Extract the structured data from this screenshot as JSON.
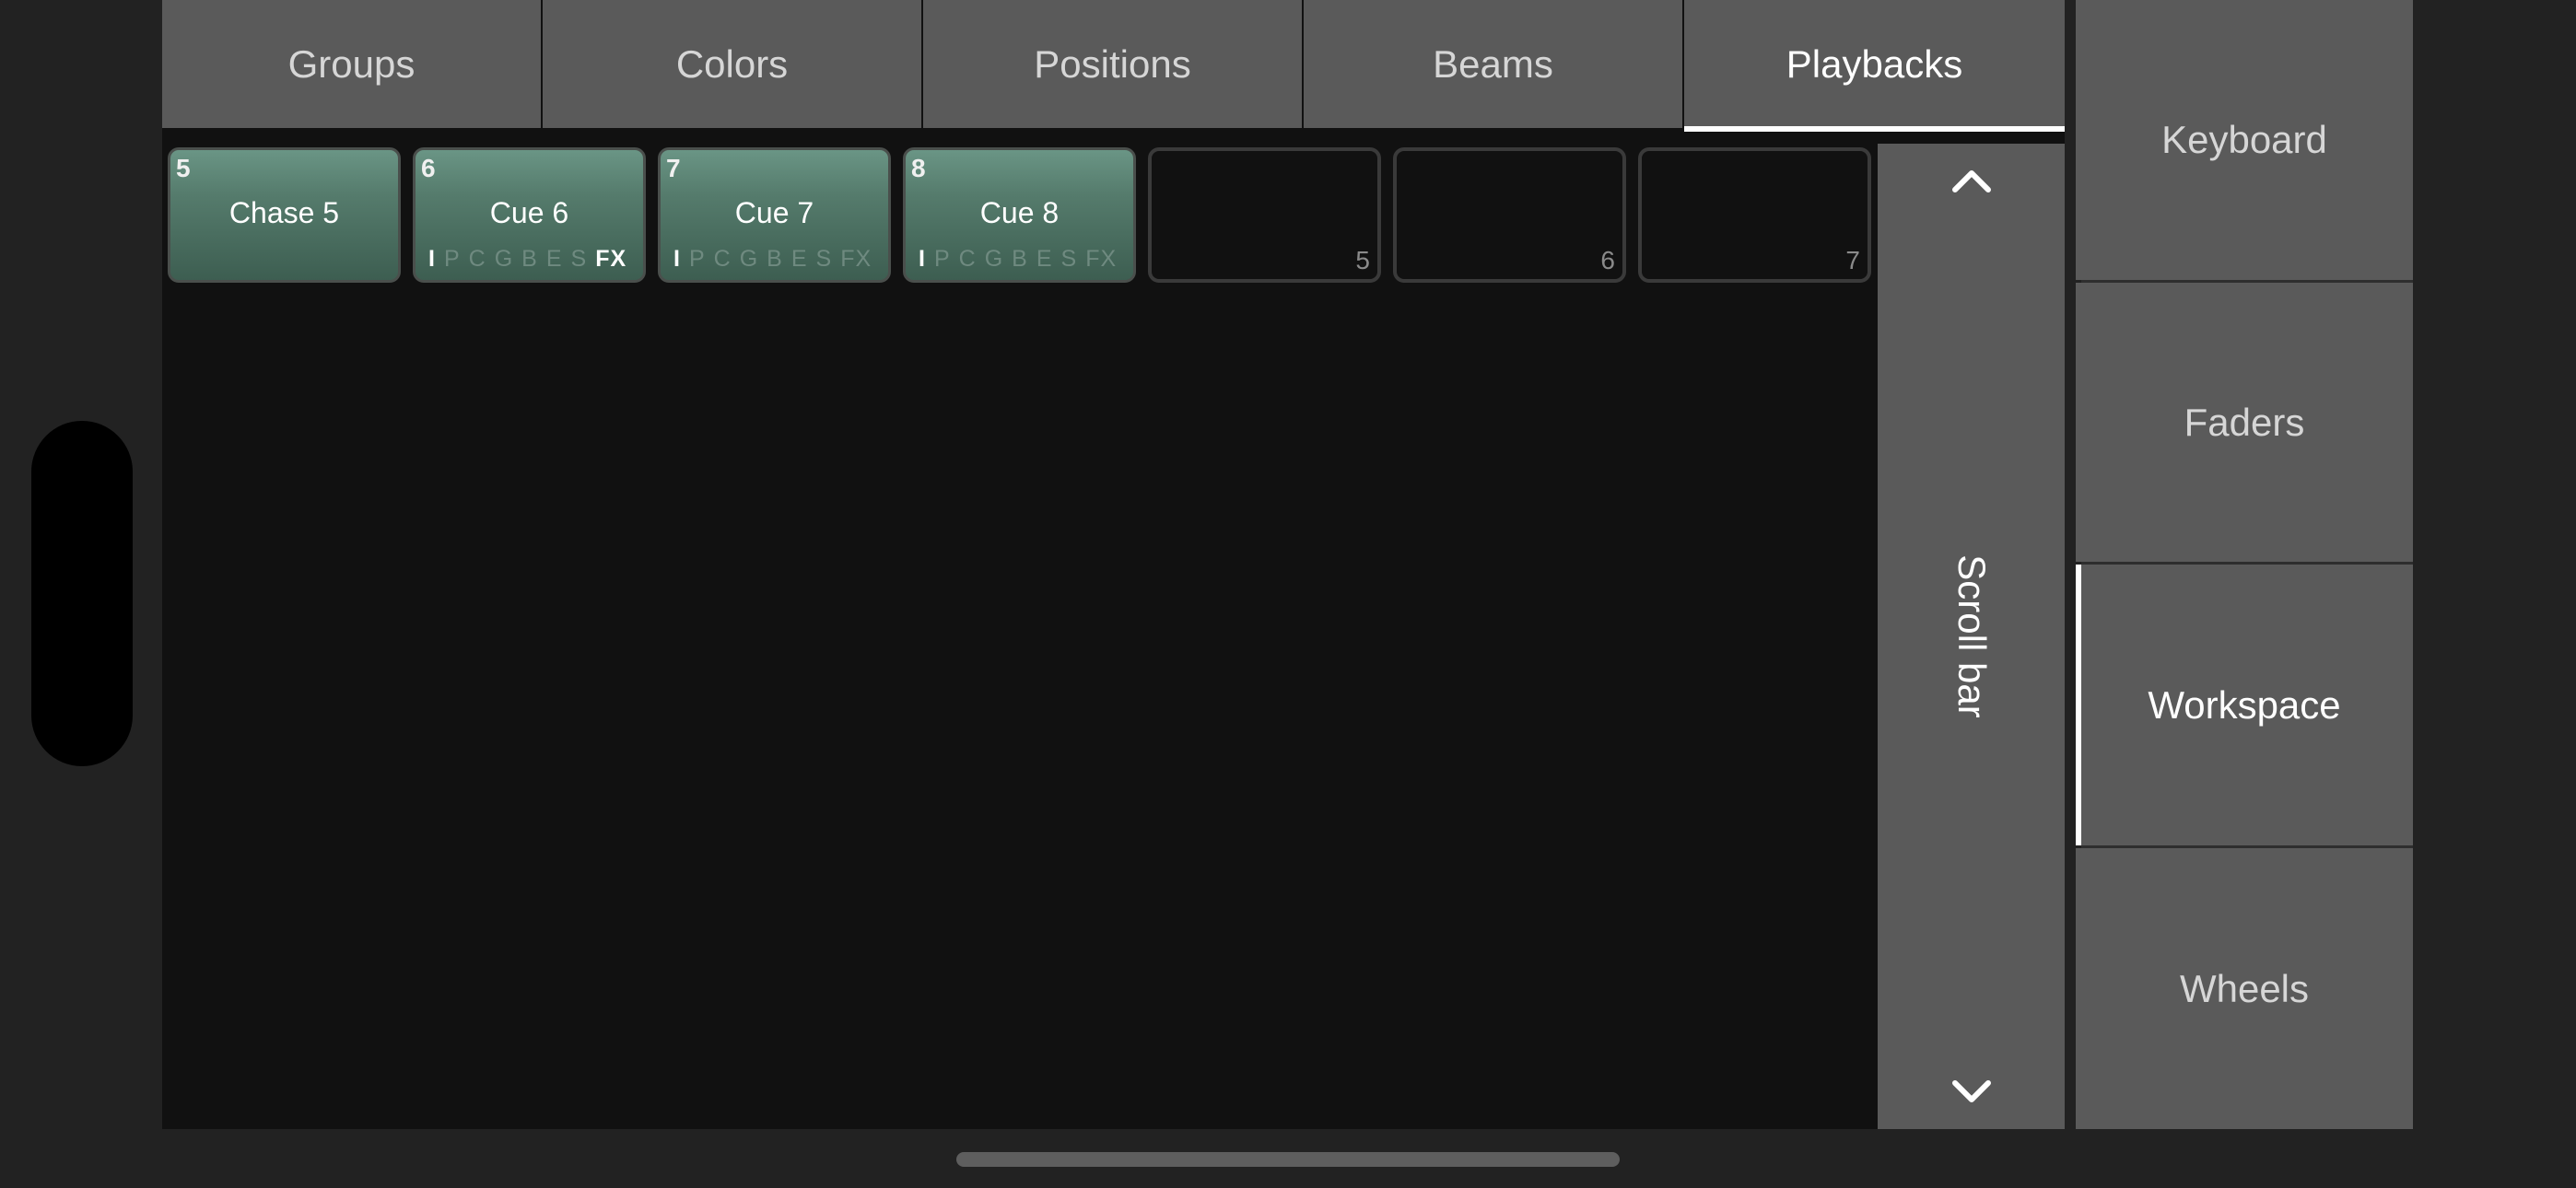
{
  "tabs": [
    {
      "label": "Groups",
      "active": false
    },
    {
      "label": "Colors",
      "active": false
    },
    {
      "label": "Positions",
      "active": false
    },
    {
      "label": "Beams",
      "active": false
    },
    {
      "label": "Playbacks",
      "active": true
    }
  ],
  "playbacks": [
    {
      "number": "5",
      "name": "Chase 5",
      "flags": []
    },
    {
      "number": "6",
      "name": "Cue 6",
      "flags": [
        {
          "label": "I",
          "on": true
        },
        {
          "label": "P",
          "on": false
        },
        {
          "label": "C",
          "on": false
        },
        {
          "label": "G",
          "on": false
        },
        {
          "label": "B",
          "on": false
        },
        {
          "label": "E",
          "on": false
        },
        {
          "label": "S",
          "on": false
        },
        {
          "label": "FX",
          "on": true
        }
      ]
    },
    {
      "number": "7",
      "name": "Cue 7",
      "flags": [
        {
          "label": "I",
          "on": true
        },
        {
          "label": "P",
          "on": false
        },
        {
          "label": "C",
          "on": false
        },
        {
          "label": "G",
          "on": false
        },
        {
          "label": "B",
          "on": false
        },
        {
          "label": "E",
          "on": false
        },
        {
          "label": "S",
          "on": false
        },
        {
          "label": "FX",
          "on": false
        }
      ]
    },
    {
      "number": "8",
      "name": "Cue 8",
      "flags": [
        {
          "label": "I",
          "on": true
        },
        {
          "label": "P",
          "on": false
        },
        {
          "label": "C",
          "on": false
        },
        {
          "label": "G",
          "on": false
        },
        {
          "label": "B",
          "on": false
        },
        {
          "label": "E",
          "on": false
        },
        {
          "label": "S",
          "on": false
        },
        {
          "label": "FX",
          "on": false
        }
      ]
    }
  ],
  "empty_slots": [
    "5",
    "6",
    "7"
  ],
  "scrollbar": {
    "label": "Scroll bar",
    "up_icon": "chevron-up-icon",
    "down_icon": "chevron-down-icon"
  },
  "sidebar": {
    "items": [
      {
        "label": "Keyboard",
        "active": false
      },
      {
        "label": "Faders",
        "active": false
      },
      {
        "label": "Workspace",
        "active": true
      },
      {
        "label": "Wheels",
        "active": false
      }
    ]
  },
  "colors": {
    "background": "#222222",
    "panel": "#111111",
    "button": "#5a5a5a",
    "playback_fill": "#557b6c",
    "accent": "#ffffff"
  }
}
